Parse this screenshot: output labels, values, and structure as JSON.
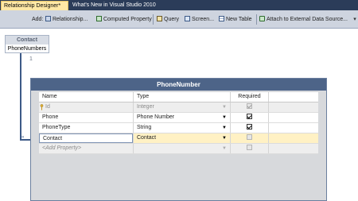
{
  "tabs": [
    {
      "label": "Relationship Designer*",
      "active": true
    },
    {
      "label": "What's New in Visual Studio 2010",
      "active": false
    }
  ],
  "toolbar": {
    "add_label": "Add:",
    "items": [
      {
        "label": "Relationship...",
        "icon": "relationship-icon"
      },
      {
        "label": "Computed Property",
        "icon": "computed-property-icon"
      },
      {
        "label": "Query",
        "icon": "query-icon"
      },
      {
        "label": "Screen...",
        "icon": "screen-icon"
      },
      {
        "label": "New Table",
        "icon": "new-table-icon"
      },
      {
        "label": "Attach to External Data Source...",
        "icon": "attach-data-source-icon"
      }
    ],
    "overflow": "▾"
  },
  "related_entity": {
    "title": "Contact",
    "field": "PhoneNumbers"
  },
  "relationship": {
    "multiplicity": "1",
    "many_marker": "∞"
  },
  "entity": {
    "title": "PhoneNumber",
    "columns": {
      "name": "Name",
      "type": "Type",
      "required": "Required"
    },
    "rows": [
      {
        "name": "Id",
        "type": "Integer",
        "required": true
      },
      {
        "name": "Phone",
        "type": "Phone Number",
        "required": true
      },
      {
        "name": "PhoneType",
        "type": "String",
        "required": true
      },
      {
        "name": "Contact",
        "type": "Contact",
        "required": false
      }
    ],
    "add_placeholder": "<Add Property>"
  },
  "colors": {
    "tabbar": "#2b3c59",
    "active_tab": "#ffe8a6",
    "entity_header": "#4d6488",
    "selected_row": "#fff1c4"
  }
}
